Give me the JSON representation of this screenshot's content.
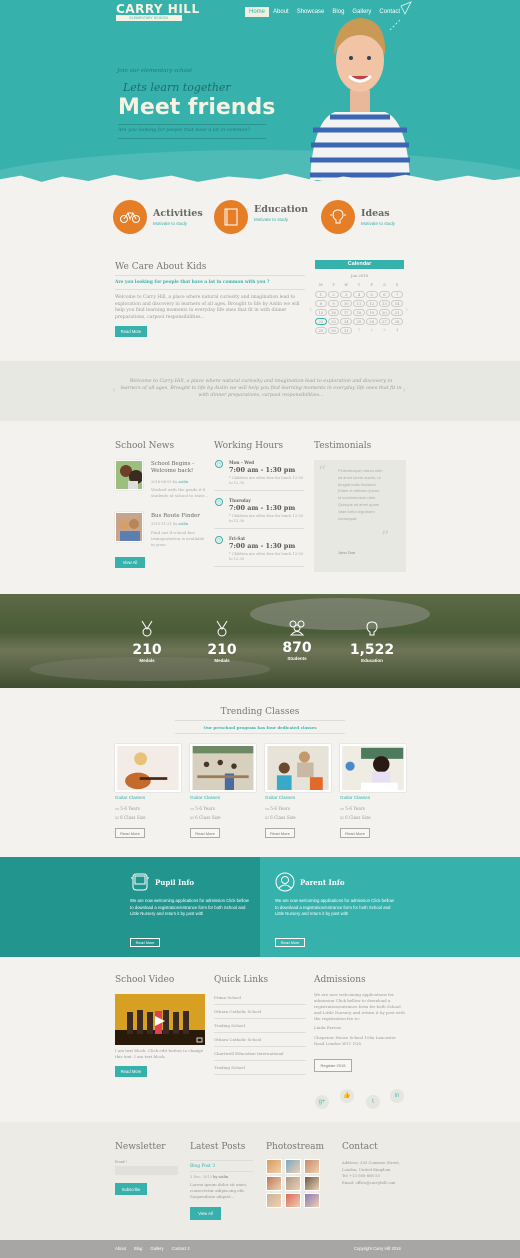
{
  "header": {
    "logo_title": "CARRY HILL",
    "logo_subtitle": "ELEMENTARY SCHOOL",
    "nav": [
      "Home",
      "About",
      "Showcase",
      "Blog",
      "Gallery",
      "Contact"
    ],
    "active_nav": "Home"
  },
  "hero": {
    "kicker": "Join our elementary school",
    "tagline": "Lets learn together",
    "headline": "Meet friends",
    "question": "Are you looking for people that have a lot in common?"
  },
  "features": [
    {
      "title": "Activities",
      "subtitle": "Motivate to study",
      "icon": "bicycle-icon"
    },
    {
      "title": "Education",
      "subtitle": "Motivate to study",
      "icon": "book-icon"
    },
    {
      "title": "Ideas",
      "subtitle": "Motivate to study",
      "icon": "lightbulb-icon"
    }
  ],
  "care": {
    "title": "We Care About Kids",
    "question": "Are you looking for people that have a lot in common with you ?",
    "body": "Welcome to Carry Hill, a place where natural curiosity and imagination lead to exploration and discovery in learners of all ages. Brought to life by Aislin we will help you find learning moments in everyday life ones that fit in with dinner preparations, carpool responsibilities...",
    "button": "Read More"
  },
  "calendar": {
    "title": "Calendar",
    "month": "Jan 2018",
    "weekdays": [
      "M",
      "T",
      "W",
      "T",
      "F",
      "S",
      "S"
    ],
    "days": [
      "1",
      "2",
      "3",
      "4",
      "5",
      "6",
      "7",
      "8",
      "9",
      "10",
      "11",
      "12",
      "13",
      "14",
      "15",
      "16",
      "17",
      "18",
      "19",
      "20",
      "21",
      "22",
      "23",
      "24",
      "25",
      "26",
      "27",
      "28",
      "29",
      "30",
      "31",
      "1",
      "2",
      "3",
      "4"
    ],
    "today": "22"
  },
  "quote_band": {
    "text": "Welcome to Carry Hill, a place where natural curiosity and imagination lead to exploration and discovery in learners of all ages. Brought to life by Aislin we will help you find learning moments in everyday life ones that fit in with dinner preparations, carpool responsibilities..."
  },
  "school_news": {
    "title": "School News",
    "items": [
      {
        "title": "School Begins - Welcome back!",
        "date": "2016-04-05",
        "by": "by",
        "author": "aislin",
        "excerpt": "Worked with the grade 6-8 students at school to raise..."
      },
      {
        "title": "Bus Route Finder",
        "date": "2015-11-21",
        "by": "by",
        "author": "aislin",
        "excerpt": "Find out if school bus transportation is available in your..."
      }
    ],
    "button": "View All"
  },
  "working_hours": {
    "title": "Working Hours",
    "items": [
      {
        "day": "Mon - Wed",
        "time": "7:00 am - 1:30 pm",
        "note": "* Children are often free for lunch 12.00 to 12.30"
      },
      {
        "day": "Thursday",
        "time": "7:00 am - 1:30 pm",
        "note": "* Children are often free for lunch 12.00 to 12.30"
      },
      {
        "day": "Fri-Sat",
        "time": "7:00 am - 1:30 pm",
        "note": "* Children are often free for lunch 12.00 to 12.30"
      }
    ]
  },
  "testimonials": {
    "title": "Testimonials",
    "quote": "Pellentesque rutrum nibh sit amet lorem auctor, ut feugiat nulla tincidunt. Etiam et ultricies ipsum, id condimentum nibh. Quisque sit amet quam vitae tortor dignissim consequat",
    "author": "John Doe"
  },
  "stats": [
    {
      "value": "210",
      "label": "Medals",
      "icon": "medal-icon"
    },
    {
      "value": "210",
      "label": "Medals",
      "icon": "medal-icon"
    },
    {
      "value": "870",
      "label": "Students",
      "icon": "students-icon"
    },
    {
      "value": "1,522",
      "label": "Education",
      "icon": "lightbulb-icon"
    }
  ],
  "trending": {
    "title": "Trending Classes",
    "subtitle": "Our preschool program has four dedicated classes",
    "classes": [
      {
        "title": "Guitar Classes",
        "age": "5-6 Years",
        "size": "6 Class Size",
        "button": "Read More"
      },
      {
        "title": "Guitar Classes",
        "age": "5-6 Years",
        "size": "6 Class Size",
        "button": "Read More"
      },
      {
        "title": "Guitar Classes",
        "age": "5-6 Years",
        "size": "6 Class Size",
        "button": "Read More"
      },
      {
        "title": "Guitar Classes",
        "age": "5-6 Years",
        "size": "6 Class Size",
        "button": "Read More"
      }
    ]
  },
  "info": {
    "pupil": {
      "title": "Pupil Info",
      "text": "We are now welcoming applications for admission Click bellow to download a registration/entrance form for both School and Little Nursery and return it by post with",
      "button": "Read More"
    },
    "parent": {
      "title": "Parent Info",
      "text": "We are now welcoming applications for admission Click bellow to download a registration/entrance form for both School and Little Nursery and return it by post with",
      "button": "Read More"
    }
  },
  "video": {
    "title": "School Video",
    "caption": "I am text block. Click edit button to change this text. I am text block.",
    "button": "Read More"
  },
  "quick_links": {
    "title": "Quick Links",
    "items": [
      "Prima School",
      "Othara Catholic School",
      "Trading School",
      "Othara Catholic School",
      "Chartwell Education International",
      "Trading School"
    ]
  },
  "admissions": {
    "title": "Admissions",
    "text": "We are now welcoming applications for admission Click bellow to download a registration/entrance form for both School and Little Nursery and return it by post with the registration fee to:",
    "name": "Linda Farrow",
    "address": "Chepstow House School 108a Lancaster Road London W11 1QS",
    "button": "Register 2015",
    "social": [
      "g+",
      "👍",
      "t",
      "in"
    ]
  },
  "newsletter": {
    "title": "Newsletter",
    "email_label": "Email *",
    "email_value": "",
    "button": "Subscribe"
  },
  "latest_posts": {
    "title": "Latest Posts",
    "post_title": "Blog Post 3",
    "date": "3 Dec, 2013",
    "author": "by aislin",
    "excerpt": "Lorem ipsum dolor sit amet, consectetur adipiscing elit. Suspendisse aliquet...",
    "button": "View All"
  },
  "photostream": {
    "title": "Photostream",
    "count": 9
  },
  "contact": {
    "title": "Contact",
    "address": "Address: 203 Common Street, London, United Kingdom",
    "tel": "Tel +13 568 668 55",
    "email": "Email: office@carryhill.com"
  },
  "footer": {
    "links": [
      "About",
      "Blog",
      "Gallery",
      "Contact 3"
    ],
    "copyright": "Copyright Carry Hill 2016"
  },
  "colors": {
    "teal": "#37b1ac",
    "dark_teal": "#23958f",
    "orange": "#e57e27",
    "cream": "#f7f3e3"
  }
}
